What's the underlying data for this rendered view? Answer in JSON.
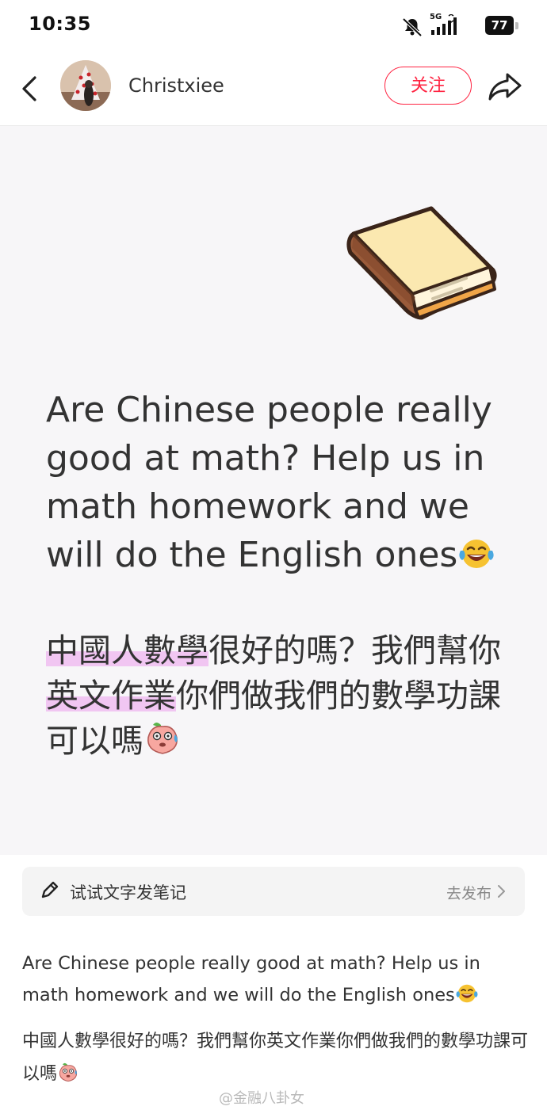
{
  "status_bar": {
    "time": "10:35",
    "network": "5G",
    "battery": "77"
  },
  "header": {
    "author_name": "Christxiee",
    "follow_label": "关注"
  },
  "post_image": {
    "english_text": "Are Chinese people really good at math? Help us in math homework and we will do the English ones",
    "chinese_highlight_1": "中國人數學",
    "chinese_part_1": "很好的嗎？我們幫你",
    "chinese_highlight_2": "英文作業",
    "chinese_part_2": "你們做我們的數學功課可以嗎"
  },
  "try_note": {
    "label": "试试文字发笔记",
    "action": "去发布"
  },
  "caption": {
    "english": "Are Chinese people really good at math? Help us in math homework and we will do the English ones",
    "chinese": "中國人數學很好的嗎？我們幫你英文作業你們做我們的數學功課可以嗎"
  },
  "watermark": "@金融八卦女",
  "icons": {
    "laughing_emoji": "face-with-tears-of-joy",
    "sweating_emoji": "peach-sweating-face"
  },
  "colors": {
    "accent": "#ff2442",
    "highlight": "#f1c6f2",
    "image_background": "#f7f6f8"
  }
}
